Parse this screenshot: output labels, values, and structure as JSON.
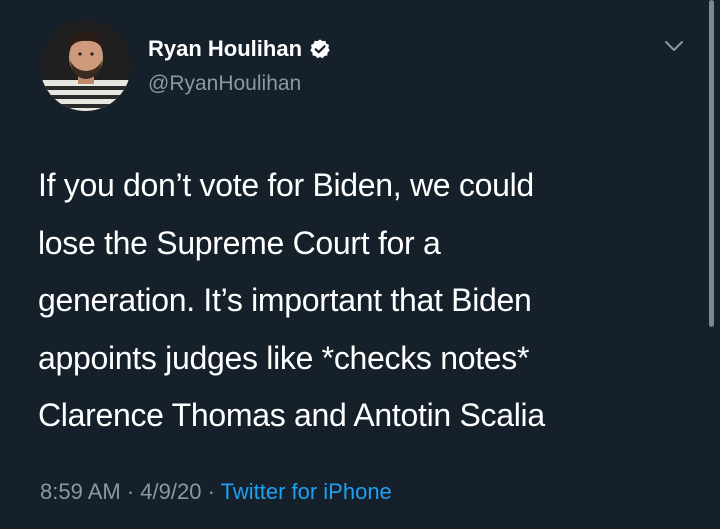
{
  "tweet": {
    "display_name": "Ryan Houlihan",
    "handle": "@RyanHoulihan",
    "verified": true,
    "body_lines": [
      "If you don’t vote for Biden, we could",
      "lose the Supreme Court for a",
      "generation. It’s important that Biden",
      "appoints judges like *checks notes*",
      "Clarence Thomas and Antotin Scalia"
    ],
    "time": "8:59 AM",
    "separator": " · ",
    "date": "4/9/20",
    "source": "Twitter for iPhone"
  },
  "icons": {
    "verified": "verified-badge-icon",
    "caret": "chevron-down-icon"
  },
  "colors": {
    "background": "#15202b",
    "text": "#ffffff",
    "secondary": "#8899a6",
    "accent": "#1da1f2"
  }
}
